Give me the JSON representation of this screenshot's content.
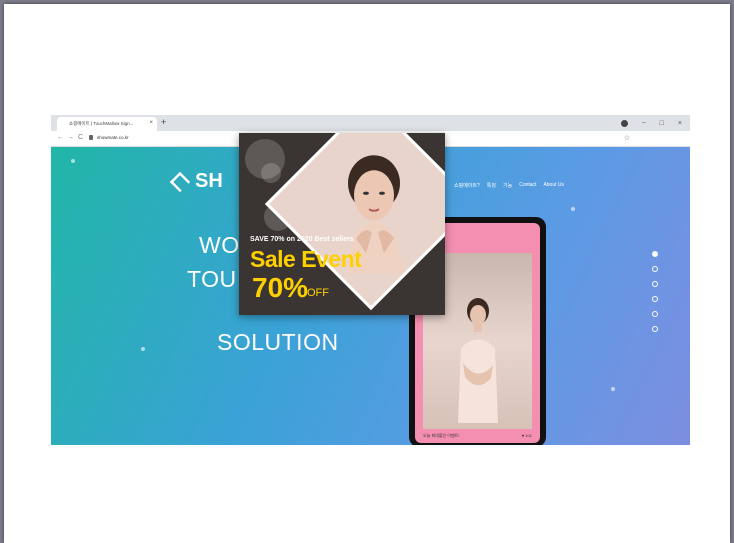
{
  "browser": {
    "tab_title": "쇼핑메이트 | TouchMallow Sign...",
    "tab_close": "×",
    "new_tab": "+",
    "url": "showmate.co.kr",
    "window_controls": {
      "minimize": "−",
      "maximize": "□",
      "close": "×"
    },
    "nav": {
      "back": "←",
      "forward": "→",
      "reload": "C"
    },
    "bookmark": "☆"
  },
  "site": {
    "logo_text": "SH",
    "nav_items": [
      "쇼핑메이트?",
      "특징",
      "기능",
      "Contact",
      "About Us"
    ],
    "hero_lines": [
      "WO",
      "TOU",
      "SOLUTION"
    ]
  },
  "phone": {
    "caption_left": "오늘 최대할인 이벤트!",
    "caption_right": "♥ 101"
  },
  "popup": {
    "subtitle": "SAVE 70% on 2020 Best sellers",
    "title": "Sale Event",
    "percent": "70%",
    "off": "OFF"
  },
  "colors": {
    "gradient_start": "#21b6a7",
    "gradient_end": "#7d8ee0",
    "accent_yellow": "#ffd000",
    "phone_screen": "#f48fb1",
    "popup_bg": "#3a3533"
  }
}
